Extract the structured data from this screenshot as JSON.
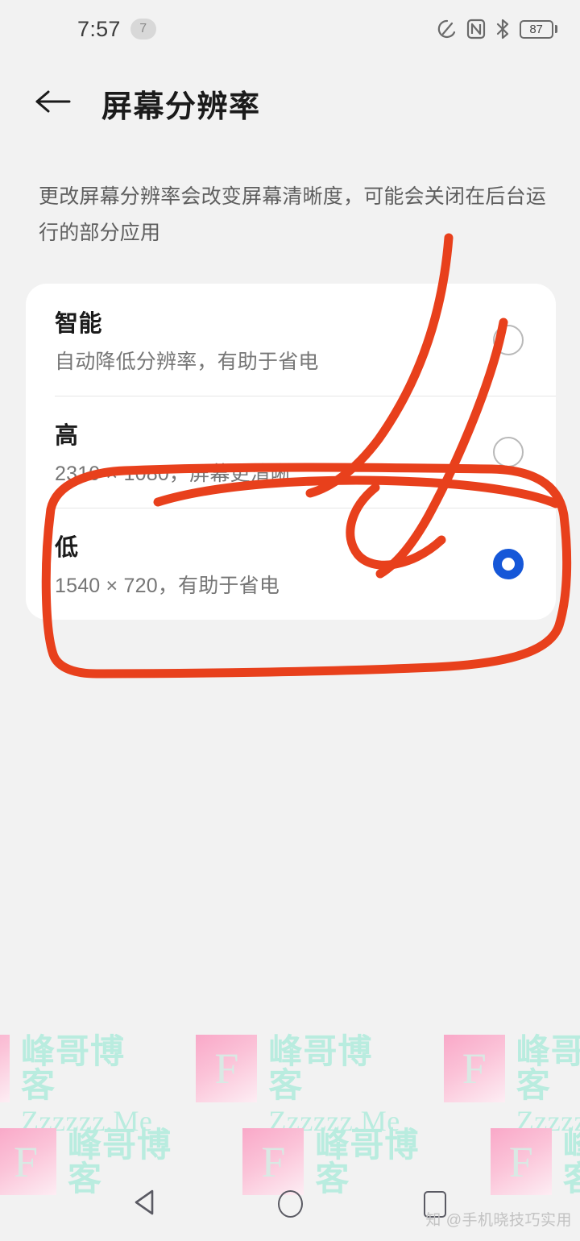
{
  "status_bar": {
    "time": "7:57",
    "notification_count": "7",
    "battery_percent": "87",
    "icons": [
      "data-saver-icon",
      "nfc-icon",
      "bluetooth-icon",
      "battery-icon"
    ]
  },
  "header": {
    "back_icon": "arrow-left-icon",
    "title": "屏幕分辨率"
  },
  "description": "更改屏幕分辨率会改变屏幕清晰度，可能会关闭在后台运行的部分应用",
  "options": [
    {
      "title": "智能",
      "subtitle": "自动降低分辨率，有助于省电",
      "selected": false
    },
    {
      "title": "高",
      "subtitle": "2310 × 1080，屏幕更清晰",
      "selected": false
    },
    {
      "title": "低",
      "subtitle": "1540 × 720，有助于省电",
      "selected": true
    }
  ],
  "annotation": {
    "color": "#e8401c",
    "description": "handwritten red marker circling the 低 option"
  },
  "watermark": {
    "logo_letter": "F",
    "cn_text": "峰哥博客",
    "en_text": "Zzzzzz.Me"
  },
  "nav_bar": {
    "back_label": "back-triangle",
    "home_label": "home-circle",
    "recents_label": "recents-square"
  },
  "attribution": "知 @手机晓技巧实用",
  "colors": {
    "accent_blue": "#1557d8",
    "background": "#f2f2f2",
    "card": "#ffffff",
    "annotation_red": "#e8401c",
    "watermark_pink": "#f9a8c8",
    "watermark_mint": "#b9ecdf"
  }
}
